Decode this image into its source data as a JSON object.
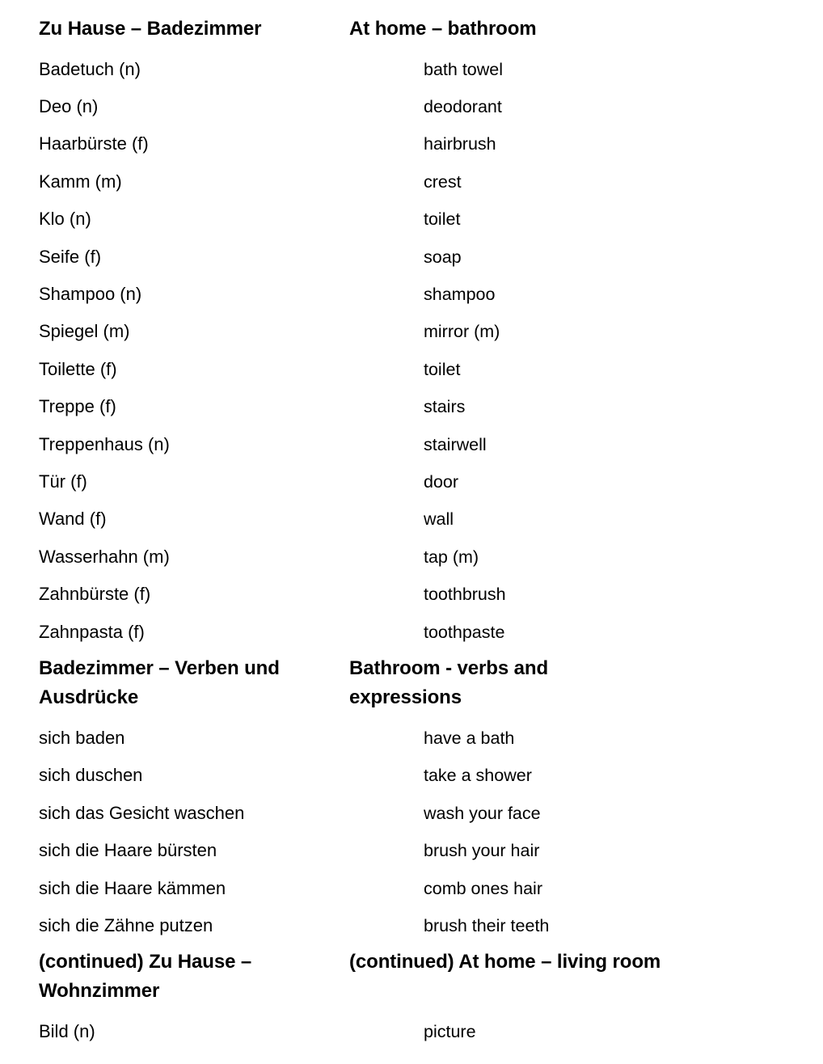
{
  "document": {
    "language_left": "German",
    "language_right": "English",
    "text_color": "#000000",
    "background_color": "#ffffff"
  },
  "sections": [
    {
      "id": "zu-hause-badezimmer",
      "heading_de": "Zu Hause – Badezimmer",
      "heading_en": "At home – bathroom",
      "entries": [
        {
          "de": "Badetuch (n)",
          "en": "bath towel"
        },
        {
          "de": "Deo (n)",
          "en": "deodorant"
        },
        {
          "de": "Haarbürste (f)",
          "en": "hairbrush"
        },
        {
          "de": "Kamm (m)",
          "en": "crest"
        },
        {
          "de": "Klo (n)",
          "en": "toilet"
        },
        {
          "de": "Seife (f)",
          "en": "soap"
        },
        {
          "de": "Shampoo (n)",
          "en": "shampoo"
        },
        {
          "de": "Spiegel (m)",
          "en": "mirror (m)"
        },
        {
          "de": "Toilette (f)",
          "en": "toilet"
        },
        {
          "de": "Treppe (f)",
          "en": "stairs"
        },
        {
          "de": "Treppenhaus (n)",
          "en": "stairwell"
        },
        {
          "de": "Tür (f)",
          "en": "door"
        },
        {
          "de": "Wand (f)",
          "en": "wall"
        },
        {
          "de": "Wasserhahn (m)",
          "en": "tap (m)"
        },
        {
          "de": "Zahnbürste (f)",
          "en": "toothbrush"
        },
        {
          "de": "Zahnpasta (f)",
          "en": "toothpaste"
        }
      ]
    },
    {
      "id": "badezimmer-verben-und-ausdruecke",
      "heading_de": "Badezimmer – Verben und Ausdrücke",
      "heading_en": "Bathroom - verbs and expressions",
      "entries": [
        {
          "de": "sich baden",
          "en": "have a bath"
        },
        {
          "de": "sich duschen",
          "en": "take a shower"
        },
        {
          "de": "sich das Gesicht waschen",
          "en": "wash your face"
        },
        {
          "de": "sich die Haare bürsten",
          "en": "brush your hair"
        },
        {
          "de": "sich die Haare kämmen",
          "en": "comb ones hair"
        },
        {
          "de": "sich die Zähne putzen",
          "en": "brush their teeth"
        }
      ]
    },
    {
      "id": "zu-hause-wohnzimmer-continued",
      "heading_de": "(continued) Zu Hause – Wohnzimmer",
      "heading_en": "(continued) At home – living room",
      "entries": [
        {
          "de": "Bild (n)",
          "en": "picture"
        }
      ]
    }
  ]
}
